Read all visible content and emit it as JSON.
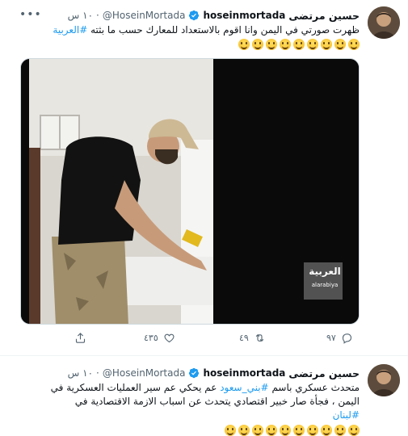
{
  "tweets": [
    {
      "display_name": "حسين مرتضى",
      "username": "hoseinmortada",
      "handle": "@HoseinMortada",
      "time": "١٠ س",
      "text": "ظهرت صورتي في اليمن وانا اقوم بالاستعداد للمعارك حسب ما بثته",
      "hashtag": "#العربية",
      "emoji_count": 9,
      "media_watermark": "العربية",
      "media_watermark_sub": "alarabiya",
      "actions": {
        "reply_count": "٩٧",
        "retweet_count": "٤٩",
        "like_count": "٤٣٥"
      }
    },
    {
      "display_name": "حسين مرتضى",
      "username": "hoseinmortada",
      "handle": "@HoseinMortada",
      "time": "١٠ س",
      "text_before": "متحدث عسكري باسم",
      "hashtag_1": "#بني_سعود",
      "text_after": "عم يحكي عم سير العمليات العسكرية في اليمن ، فجأة صار خبير اقتصادي يتحدث عن اسباب الازمة الاقتصادية في",
      "hashtag_2": "#لبنان",
      "emoji_count": 10
    }
  ],
  "colors": {
    "accent": "#1d9bf0",
    "secondary_text": "#536471",
    "divider": "#eff3f4"
  },
  "icons": {
    "verified": "verified-badge-icon",
    "more": "more-icon",
    "reply": "reply-icon",
    "retweet": "retweet-icon",
    "like": "heart-icon",
    "share": "share-icon"
  }
}
